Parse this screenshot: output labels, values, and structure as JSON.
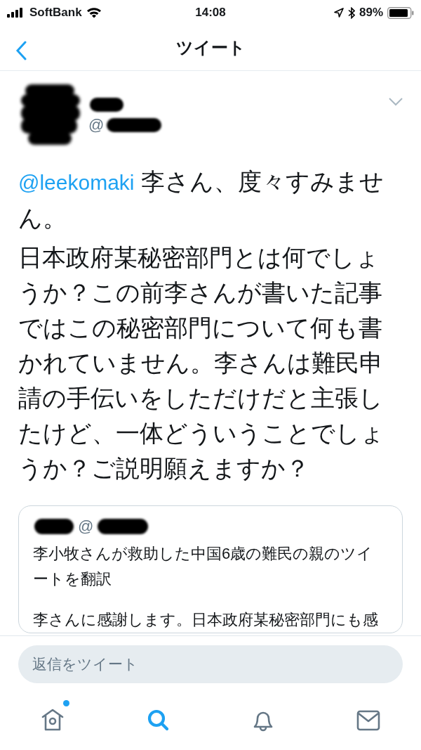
{
  "status_bar": {
    "carrier": "SoftBank",
    "time": "14:08",
    "battery": "89%"
  },
  "nav": {
    "title": "ツイート"
  },
  "tweet": {
    "handle_prefix": "@",
    "mention": "@leekomaki",
    "intro": " 李さん、度々すみません。",
    "body": "日本政府某秘密部門とは何でしょうか？この前李さんが書いた記事ではこの秘密部門について何も書かれていません。李さんは難民申請の手伝いをしただけだと主張したけど、一体どういうことでしょうか？ご説明願えますか？"
  },
  "quote": {
    "handle_prefix": "@",
    "paragraphs": [
      "李小牧さんが救助した中国6歳の難民の親のツイートを翻訳",
      "李さんに感謝します。日本政府某秘密部門にも感"
    ]
  },
  "reply": {
    "placeholder": "返信をツイート"
  },
  "tabs": [
    {
      "kind": "home",
      "selected": false,
      "unread": true
    },
    {
      "kind": "search",
      "selected": true,
      "unread": false
    },
    {
      "kind": "notifications",
      "selected": false,
      "unread": false
    },
    {
      "kind": "messages",
      "selected": false,
      "unread": false
    }
  ]
}
